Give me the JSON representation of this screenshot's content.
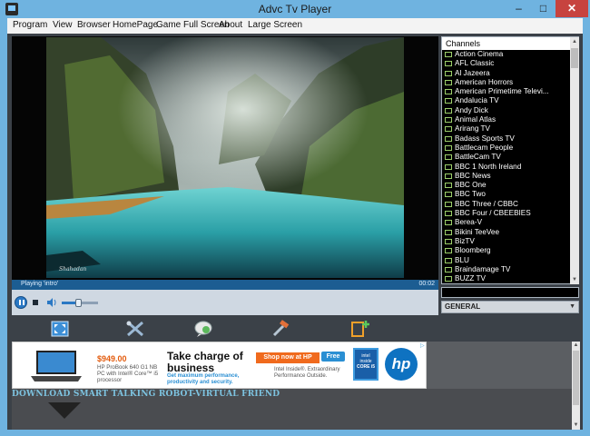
{
  "window": {
    "title": "Advc Tv Player",
    "minimize": "–",
    "maximize": "□",
    "close": "✕"
  },
  "menu": [
    "Program",
    "View",
    "Browser",
    "HomePage",
    "Game Full Screen",
    "About",
    "Large Screen"
  ],
  "player": {
    "status": "Playing 'intro'",
    "time": "00:02",
    "watermark": "Shahadan",
    "volume": 0.45
  },
  "channels": {
    "header": "Channels",
    "items": [
      "Action Cinema",
      "AFL Classic",
      "Al Jazeera",
      "American Horrors",
      "American Primetime Televi...",
      "Andalucia TV",
      "Andy Dick",
      "Animal Atlas",
      "Arirang TV",
      "Badass Sports TV",
      "Battlecam People",
      "BattleCam TV",
      "BBC 1 North Ireland",
      "BBC News",
      "BBC One",
      "BBC Two",
      "BBC Three / CBBC",
      "BBC Four / CBEEBIES",
      "Berea-V",
      "Bikini TeeVee",
      "BizTV",
      "Bloomberg",
      "BLU",
      "Braindamage TV",
      "BUZZ TV"
    ],
    "genre": "GENERAL"
  },
  "toolbar": [
    "fullscreen-icon",
    "tools-icon",
    "chat-icon",
    "hammer-icon",
    "add-channel-icon"
  ],
  "ad": {
    "price": "$949.00",
    "model": "HP ProBook 640 G1 NB PC with Intel® Core™ i5 processor",
    "headline": "Take charge of business",
    "sub": "Get maximum performance, productivity and security.",
    "shop": "Shop now at HP",
    "free": "Free",
    "intel": "Intel Inside®. Extraordinary Performance Outside.",
    "badge_line1": "intel",
    "badge_line2": "inside",
    "badge_line3": "CORE i5",
    "hp_logo": "hp"
  },
  "banner": {
    "text": "DOWNLOAD SMART TALKING ROBOT-VIRTUAL FRIEND"
  },
  "colors": {
    "titlebar": "#6fb3e0",
    "client": "#3b4148",
    "status": "#1c5d92",
    "close": "#c7433f",
    "accent": "#2a78c4"
  }
}
